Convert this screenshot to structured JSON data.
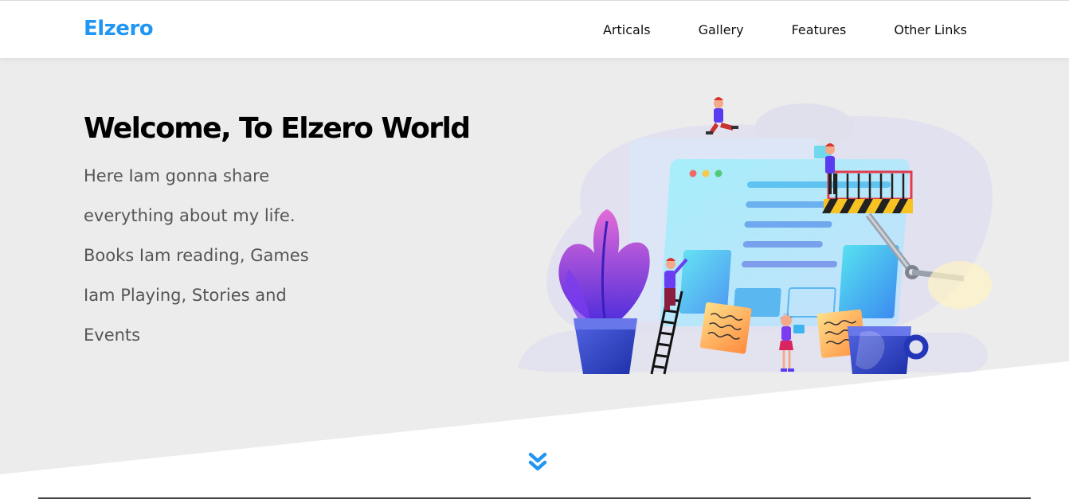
{
  "header": {
    "logo": "Elzero",
    "nav": [
      "Articals",
      "Gallery",
      "Features",
      "Other Links"
    ]
  },
  "hero": {
    "title": "Welcome, To Elzero World",
    "text": "Here Iam gonna share everything about my life. Books Iam reading, Games Iam Playing, Stories and Events"
  },
  "icons": {
    "scroll": "double-chevron-down-icon",
    "illustration": "web-design-team-illustration"
  },
  "colors": {
    "accent": "#2196f3",
    "landing_bg": "#ececec",
    "title": "#000000",
    "text": "#555555"
  }
}
